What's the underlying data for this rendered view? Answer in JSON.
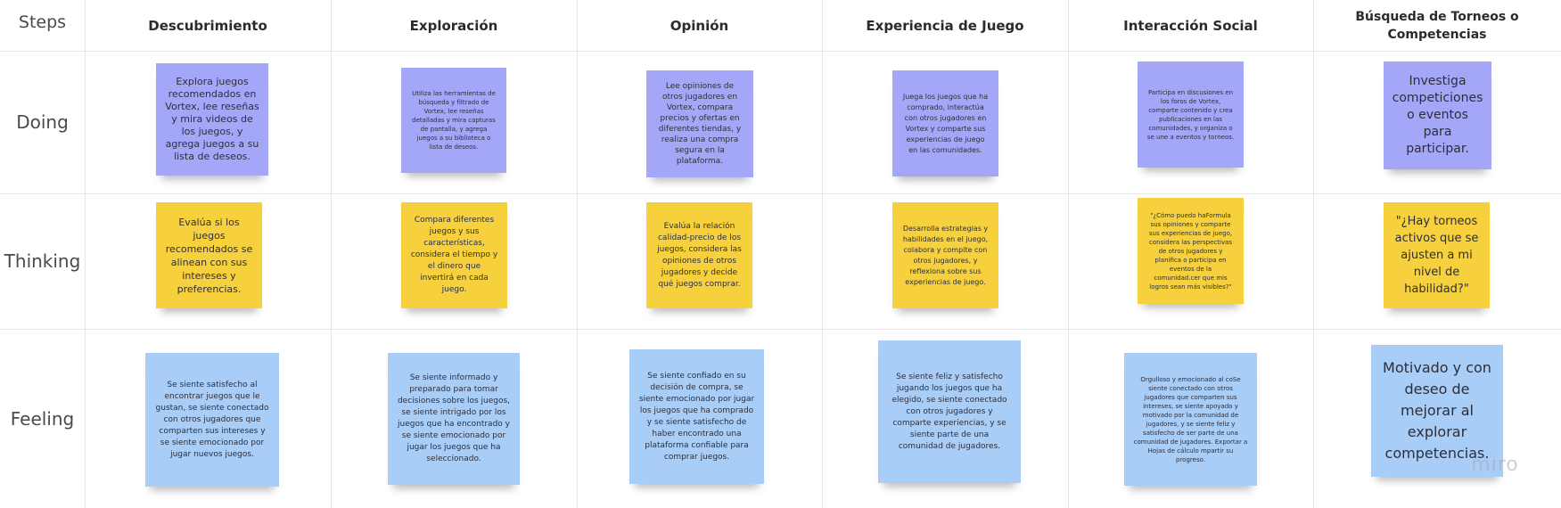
{
  "board": {
    "steps_label": "Steps",
    "watermark": "miro"
  },
  "columns": [
    "Descubrimiento",
    "Exploración",
    "Opinión",
    "Experiencia de Juego",
    "Interacción Social",
    "Búsqueda de Torneos o Competencias"
  ],
  "rows": [
    "Doing",
    "Thinking",
    "Feeling"
  ],
  "notes": {
    "doing": [
      "Explora juegos recomendados en Vortex, lee reseñas y mira videos de los juegos, y agrega juegos a su lista de deseos.",
      "Utiliza las herramientas de búsqueda y filtrado de Vortex, lee reseñas detalladas y mira capturas de pantalla, y agrega juegos a su biblioteca o lista de deseos.",
      "Lee opiniones de otros jugadores en Vortex, compara precios y ofertas en diferentes tiendas, y realiza una compra segura en la plataforma.",
      "Juega los juegos que ha comprado, interactúa con otros jugadores en Vortex y comparte sus experiencias de juego en las comunidades.",
      "Participa en discusiones en los foros de Vortex, comparte contenido y crea publicaciones en las comunidades, y organiza o se une a eventos y torneos.",
      "Investiga competiciones o eventos para participar."
    ],
    "thinking": [
      "Evalúa si los juegos recomendados se alinean con sus intereses y preferencias.",
      "Compara diferentes juegos y sus características, considera el tiempo y el dinero que invertirá en cada juego.",
      "Evalúa la relación calidad-precio de los juegos, considera las opiniones de otros jugadores y decide qué juegos comprar.",
      "Desarrolla estrategias y habilidades en el juego, colabora y compite con otros jugadores, y reflexiona sobre sus experiencias de juego.",
      "\"¿Cómo puedo haFormula sus opiniones y comparte sus experiencias de juego, considera las perspectivas de otros jugadores y planifica o participa en eventos de la comunidad.cer que mis logros sean más visibles?\"",
      "\"¿Hay torneos activos que se ajusten a mi nivel de habilidad?\""
    ],
    "feeling": [
      "Se siente satisfecho al encontrar juegos que le gustan, se siente conectado con otros jugadores que comparten sus intereses y se siente emocionado por jugar nuevos juegos.",
      "Se siente informado y preparado para tomar decisiones sobre los juegos, se siente intrigado por los juegos que ha encontrado y se siente emocionado por jugar los juegos que ha seleccionado.",
      "Se siente confiado en su decisión de compra, se siente emocionado por jugar los juegos que ha comprado y se siente satisfecho de haber encontrado una plataforma confiable para comprar juegos.",
      "Se siente feliz y satisfecho jugando los juegos que ha elegido, se siente conectado con otros jugadores y comparte experiencias, y se siente parte de una comunidad de jugadores.",
      "Orgulloso y emocionado al coSe siente conectado con otros jugadores que comparten sus intereses, se siente apoyado y motivado por la comunidad de jugadores, y se siente feliz y satisfecho de ser parte de una comunidad de jugadores. Exportar a Hojas de cálculo mpartir su progreso.",
      "Motivado y con deseo de mejorar al explorar competencias."
    ]
  }
}
